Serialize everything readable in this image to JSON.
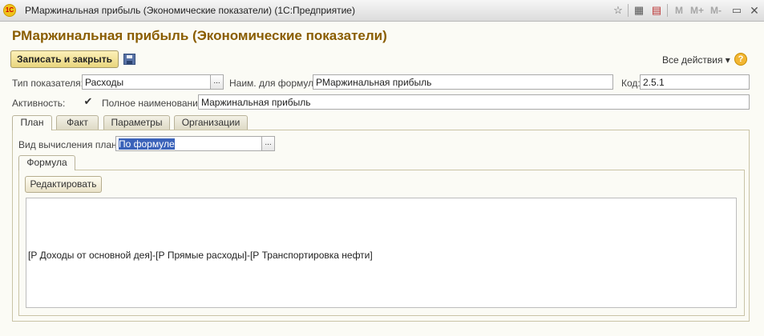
{
  "window": {
    "logo": "1C",
    "title": "РМаржинальная прибыль (Экономические показатели)  (1С:Предприятие)",
    "toolbar": {
      "m": "M",
      "m_plus": "M+",
      "m_minus": "M-"
    }
  },
  "page": {
    "title": "РМаржинальная прибыль (Экономические показатели)"
  },
  "command_bar": {
    "save_close_label": "Записать и закрыть",
    "all_actions_label": "Все действия ▾",
    "help_label": "?"
  },
  "form": {
    "type_label": "Тип показателя:",
    "type_value": "Расходы",
    "formula_name_label": "Наим. для формул:",
    "formula_name_value": "РМаржинальная прибыль",
    "code_label": "Код:",
    "code_value": "2.5.1",
    "activity_label": "Активность:",
    "activity_checked": true,
    "full_name_label": "Полное наименование:",
    "full_name_value": "Маржинальная прибыль",
    "select_glyph": "..."
  },
  "tabs": [
    {
      "label": "План",
      "active": true
    },
    {
      "label": "Факт",
      "active": false
    },
    {
      "label": "Параметры",
      "active": false
    },
    {
      "label": "Организации",
      "active": false
    }
  ],
  "plan": {
    "calc_type_label": "Вид вычисления план:",
    "calc_type_value": "По формуле",
    "inner_tab": "Формула",
    "edit_label": "Редактировать",
    "formula_text": "[Р Доходы от основной дея]-[Р Прямые расходы]-[Р Транспортировка нефти]"
  }
}
